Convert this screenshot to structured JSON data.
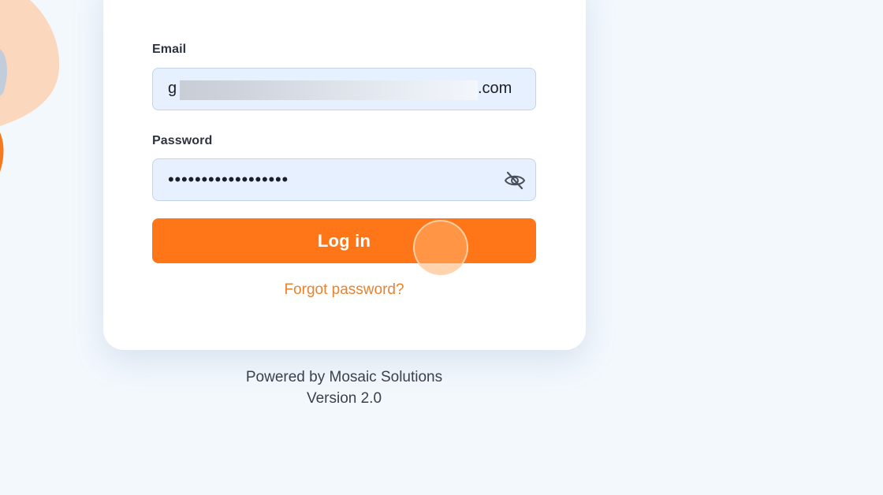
{
  "form": {
    "email_label": "Email",
    "email_value_start": "g",
    "email_value_end": ".com",
    "password_label": "Password",
    "password_masked": "••••••••••••••••••",
    "toggle_icon": "eye-slash-icon",
    "login_label": "Log in",
    "forgot_label": "Forgot password?"
  },
  "footer": {
    "powered_by": "Powered by Mosaic Solutions",
    "version": "Version 2.0"
  },
  "colors": {
    "accent": "#ff7618",
    "link": "#e8822d",
    "input_background": "#e6f0ff",
    "page_background": "#f3f8fd"
  }
}
